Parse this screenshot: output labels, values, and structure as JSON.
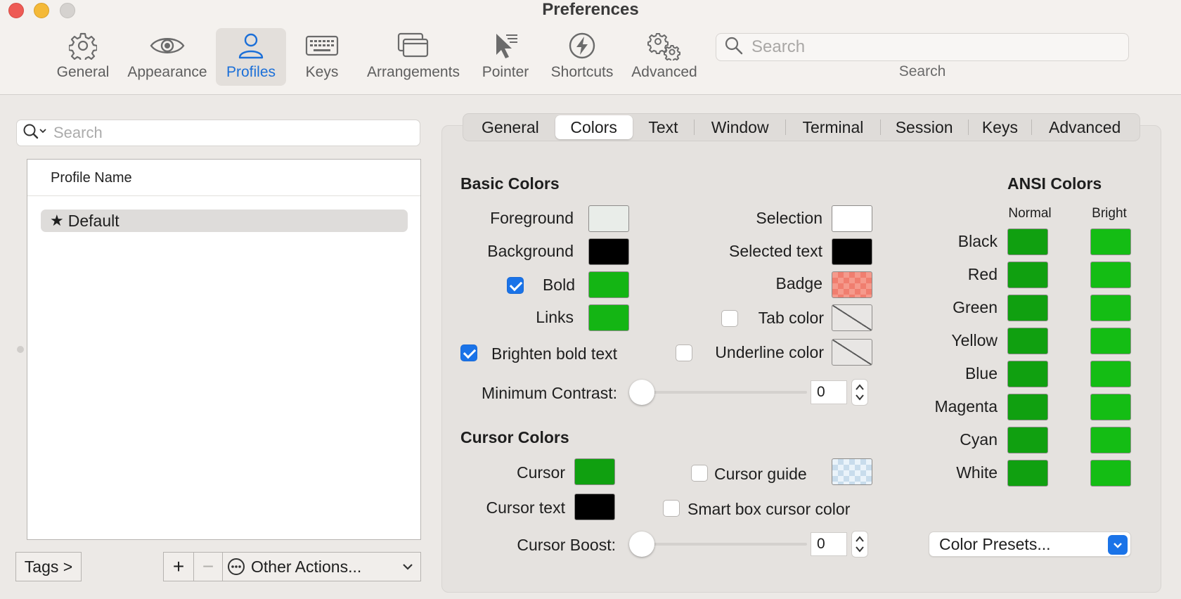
{
  "window": {
    "title": "Preferences"
  },
  "toolbar": {
    "items": [
      {
        "label": "General",
        "icon": "gear-icon",
        "selected": false
      },
      {
        "label": "Appearance",
        "icon": "eye-icon",
        "selected": false
      },
      {
        "label": "Profiles",
        "icon": "person-icon",
        "selected": true
      },
      {
        "label": "Keys",
        "icon": "keyboard-icon",
        "selected": false
      },
      {
        "label": "Arrangements",
        "icon": "windows-icon",
        "selected": false
      },
      {
        "label": "Pointer",
        "icon": "pointer-icon",
        "selected": false
      },
      {
        "label": "Shortcuts",
        "icon": "bolt-icon",
        "selected": false
      },
      {
        "label": "Advanced",
        "icon": "gears-icon",
        "selected": false
      }
    ],
    "search": {
      "placeholder": "Search",
      "label": "Search"
    }
  },
  "profiles": {
    "search_placeholder": "Search",
    "column_header": "Profile Name",
    "rows": [
      {
        "name": "Default",
        "icon": "star-icon",
        "selected": true
      }
    ],
    "tags_button": "Tags >",
    "add_symbol": "+",
    "remove_symbol": "−",
    "other_actions": "Other Actions..."
  },
  "tabs": [
    {
      "label": "General",
      "selected": false
    },
    {
      "label": "Colors",
      "selected": true
    },
    {
      "label": "Text",
      "selected": false
    },
    {
      "label": "Window",
      "selected": false
    },
    {
      "label": "Terminal",
      "selected": false
    },
    {
      "label": "Session",
      "selected": false
    },
    {
      "label": "Keys",
      "selected": false
    },
    {
      "label": "Advanced",
      "selected": false
    }
  ],
  "basic_colors": {
    "heading": "Basic Colors",
    "foreground": {
      "label": "Foreground",
      "color": "#e9ede9"
    },
    "background": {
      "label": "Background",
      "color": "#000000"
    },
    "bold": {
      "label": "Bold",
      "checked": true,
      "color": "#14b514"
    },
    "links": {
      "label": "Links",
      "color": "#14b514"
    },
    "selection": {
      "label": "Selection",
      "color": "#ffffff"
    },
    "selected_text": {
      "label": "Selected text",
      "color": "#000000"
    },
    "badge": {
      "label": "Badge",
      "color": "#f59a8c"
    },
    "tab_color": {
      "label": "Tab color",
      "checked": false
    },
    "underline_color": {
      "label": "Underline color",
      "checked": false
    },
    "brighten_bold": {
      "label": "Brighten bold text",
      "checked": true
    },
    "minimum_contrast": {
      "label": "Minimum Contrast:",
      "value": "0",
      "slider_fraction": 0
    }
  },
  "cursor_colors": {
    "heading": "Cursor Colors",
    "cursor": {
      "label": "Cursor",
      "color": "#10a010"
    },
    "cursor_text": {
      "label": "Cursor text",
      "color": "#000000"
    },
    "cursor_guide": {
      "label": "Cursor guide",
      "checked": false
    },
    "smart_box": {
      "label": "Smart box cursor color",
      "checked": false
    },
    "cursor_boost": {
      "label": "Cursor Boost:",
      "value": "0",
      "slider_fraction": 0
    }
  },
  "ansi_colors": {
    "heading": "ANSI Colors",
    "normal_label": "Normal",
    "bright_label": "Bright",
    "normal_color": "#10a010",
    "bright_color": "#14bd14",
    "rows": [
      "Black",
      "Red",
      "Green",
      "Yellow",
      "Blue",
      "Magenta",
      "Cyan",
      "White"
    ]
  },
  "color_presets": {
    "label": "Color Presets..."
  },
  "accent_color": "#1a73e8"
}
